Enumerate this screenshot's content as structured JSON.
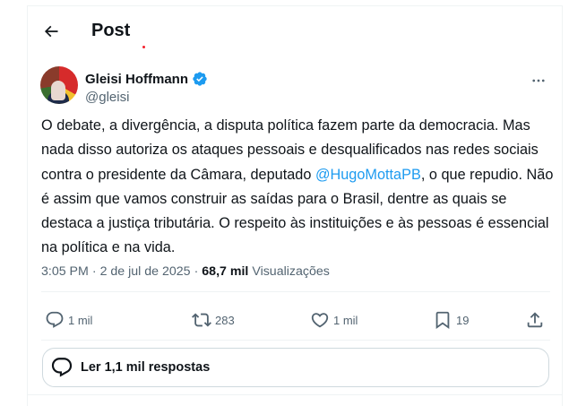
{
  "header": {
    "title": "Post",
    "back_icon": "arrow-left-icon"
  },
  "author": {
    "display_name": "Gleisi Hoffmann",
    "handle": "@gleisi",
    "verified_color": "#1d9bf0"
  },
  "tweet": {
    "text_before": "O debate, a divergência, a disputa política fazem parte da democracia. Mas nada disso autoriza os ataques pessoais e desqualificados nas redes sociais contra o presidente da Câmara, deputado ",
    "mention": "@HugoMottaPB",
    "text_after": ", o que repudio. Não é assim que vamos construir as saídas para o Brasil, dentre as quais se destaca a justiça tributária. O respeito às instituições e às pessoas é essencial na política e na vida.",
    "time": "3:05 PM",
    "dot": "·",
    "date": "2 de jul de 2025",
    "views_count": "68,7 mil",
    "views_label": "Visualizações"
  },
  "actions": {
    "replies": "1 mil",
    "reposts": "283",
    "likes": "1 mil",
    "bookmarks": "19"
  },
  "replies_button": {
    "label": "Ler 1,1 mil respostas"
  },
  "colors": {
    "accent": "#1d9bf0",
    "text": "#0f1419",
    "muted": "#536471",
    "border": "#eff3f4"
  }
}
